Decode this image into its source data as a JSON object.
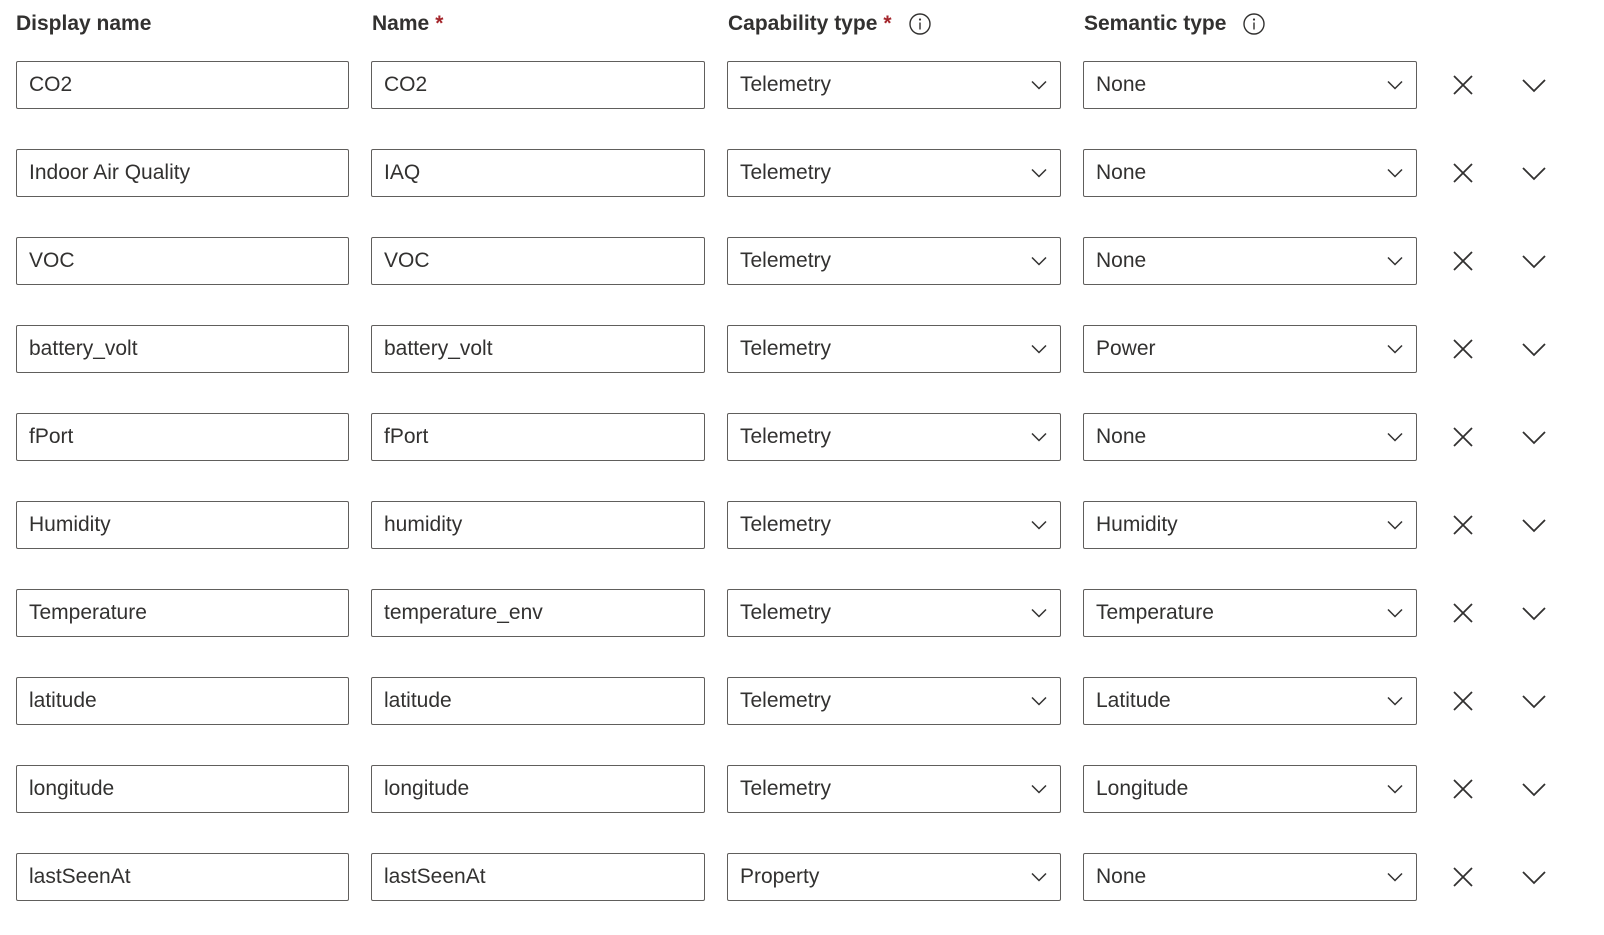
{
  "columns": {
    "display_name": "Display name",
    "name": "Name",
    "capability_type": "Capability type",
    "semantic_type": "Semantic type",
    "required_marker": "*"
  },
  "icons": {
    "info": "info-icon",
    "dropdown": "chevron-down-icon",
    "delete": "close-icon",
    "expand": "chevron-down-icon"
  },
  "colors": {
    "required": "#a4262c",
    "border": "#605e5c",
    "text": "#323130"
  },
  "rows": [
    {
      "display_name": "CO2",
      "name": "CO2",
      "capability_type": "Telemetry",
      "semantic_type": "None"
    },
    {
      "display_name": "Indoor Air Quality",
      "name": "IAQ",
      "capability_type": "Telemetry",
      "semantic_type": "None"
    },
    {
      "display_name": "VOC",
      "name": "VOC",
      "capability_type": "Telemetry",
      "semantic_type": "None"
    },
    {
      "display_name": "battery_volt",
      "name": "battery_volt",
      "capability_type": "Telemetry",
      "semantic_type": "Power"
    },
    {
      "display_name": "fPort",
      "name": "fPort",
      "capability_type": "Telemetry",
      "semantic_type": "None"
    },
    {
      "display_name": "Humidity",
      "name": "humidity",
      "capability_type": "Telemetry",
      "semantic_type": "Humidity"
    },
    {
      "display_name": "Temperature",
      "name": "temperature_env",
      "capability_type": "Telemetry",
      "semantic_type": "Temperature"
    },
    {
      "display_name": "latitude",
      "name": "latitude",
      "capability_type": "Telemetry",
      "semantic_type": "Latitude"
    },
    {
      "display_name": "longitude",
      "name": "longitude",
      "capability_type": "Telemetry",
      "semantic_type": "Longitude"
    },
    {
      "display_name": "lastSeenAt",
      "name": "lastSeenAt",
      "capability_type": "Property",
      "semantic_type": "None"
    }
  ]
}
